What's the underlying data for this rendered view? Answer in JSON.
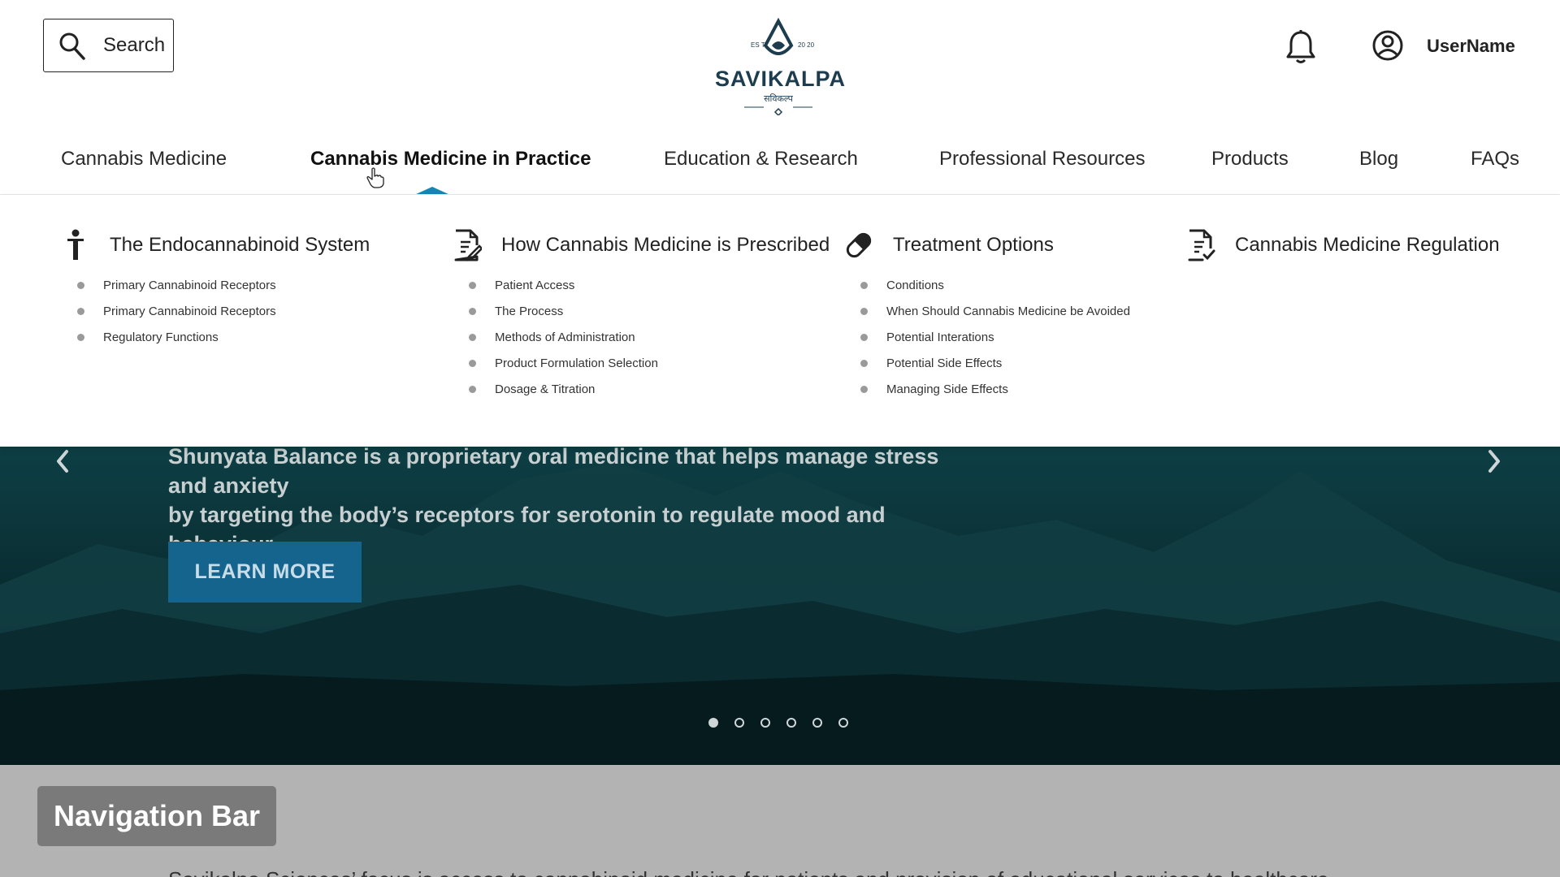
{
  "header": {
    "search_label": "Search",
    "logo": {
      "name": "SAVIKALPA",
      "subtitle": "सविकल्प",
      "est_left": "ES T.",
      "est_right": "20 20"
    },
    "username": "UserName"
  },
  "nav": {
    "items": [
      {
        "label": "Cannabis Medicine",
        "active": false
      },
      {
        "label": "Cannabis Medicine in Practice",
        "active": true
      },
      {
        "label": "Education & Research",
        "active": false
      },
      {
        "label": "Professional Resources",
        "active": false
      },
      {
        "label": "Products",
        "active": false
      },
      {
        "label": "Blog",
        "active": false
      },
      {
        "label": "FAQs",
        "active": false
      }
    ]
  },
  "mega_menu": {
    "columns": [
      {
        "title": "The Endocannabinoid System",
        "icon": "person-icon",
        "items": [
          "Primary Cannabinoid Receptors",
          "Primary Cannabinoid Receptors",
          "Regulatory Functions"
        ]
      },
      {
        "title": "How Cannabis Medicine is Prescribed",
        "icon": "document-pen-icon",
        "items": [
          "Patient Access",
          "The Process",
          "Methods of Administration",
          "Product Formulation Selection",
          "Dosage & Titration"
        ]
      },
      {
        "title": "Treatment Options",
        "icon": "pill-icon",
        "items": [
          "Conditions",
          "When Should Cannabis Medicine be Avoided",
          "Potential Interations",
          "Potential Side Effects",
          "Managing Side Effects"
        ]
      },
      {
        "title": "Cannabis Medicine Regulation",
        "icon": "document-check-icon",
        "items": []
      }
    ]
  },
  "hero": {
    "text_line1": "Shunyata Balance is a proprietary oral medicine that helps manage stress and anxiety",
    "text_line2": "by targeting the body’s receptors for serotonin to regulate mood and behaviour.",
    "button_label": "LEARN MORE",
    "slide_count": 6,
    "active_slide": 1
  },
  "annotation": {
    "tag": "Navigation Bar",
    "body_text": "Savikalpa Sciences’ focus is access to cannabinoid medicine for patients and provision of educational services to healthcare"
  },
  "colors": {
    "accent": "#1585b7",
    "button": "#14648e",
    "brand": "#1d3d4f",
    "annotation_bg": "#b3b3b3",
    "tag_bg": "#7a7a7a"
  }
}
